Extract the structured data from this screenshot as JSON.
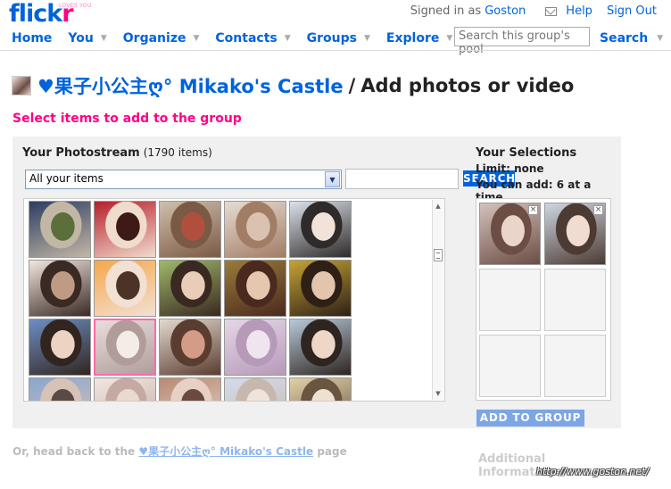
{
  "header": {
    "logo_text": "flick",
    "logo_r": "r",
    "logo_sub": "LOVES YOU",
    "signed_in_as": "Signed in as",
    "username": "Goston",
    "help": "Help",
    "sign_out": "Sign Out",
    "nav": [
      "Home",
      "You",
      "Organize",
      "Contacts",
      "Groups",
      "Explore"
    ],
    "search_placeholder": "Search this group's pool",
    "search_label": "Search"
  },
  "page": {
    "group_name": "♥果子小公主ღ° Mikako's Castle",
    "separator": "/",
    "title_rest": "Add photos or video",
    "subhead": "Select items to add to the group"
  },
  "photostream": {
    "label": "Your Photostream",
    "count": "(1790 items)",
    "filter_selected": "All your items",
    "search_button": "SEARCH"
  },
  "thumbnails": [
    {
      "c1": "#2d3d62",
      "c2": "#c2b7a5",
      "c3": "#5a6f3a",
      "selected": false
    },
    {
      "c1": "#b61f2b",
      "c2": "#f0dccd",
      "c3": "#3d1a16",
      "selected": false
    },
    {
      "c1": "#cfbfae",
      "c2": "#7b5a45",
      "c3": "#b14f3e",
      "selected": false
    },
    {
      "c1": "#e6dcd2",
      "c2": "#a27d66",
      "c3": "#d9c2b0",
      "selected": false
    },
    {
      "c1": "#dbe1ea",
      "c2": "#2f2b2a",
      "c3": "#f2e3d8",
      "selected": false
    },
    {
      "c1": "#f1e6df",
      "c2": "#3b2a24",
      "c3": "#bf9b86",
      "selected": false
    },
    {
      "c1": "#f5a74a",
      "c2": "#f3e0d4",
      "c3": "#4c3327",
      "selected": false
    },
    {
      "c1": "#9fb86b",
      "c2": "#3a2921",
      "c3": "#e8cdb8",
      "selected": false
    },
    {
      "c1": "#9a7b3b",
      "c2": "#4a2a1e",
      "c3": "#e5c7b0",
      "selected": false
    },
    {
      "c1": "#c4a335",
      "c2": "#2f2016",
      "c3": "#e3c5ae",
      "selected": false
    },
    {
      "c1": "#6c8ec3",
      "c2": "#32251f",
      "c3": "#ecd3c2",
      "selected": false
    },
    {
      "c1": "#d7c2c2",
      "c2": "#6f4e45",
      "c3": "#efdcd3",
      "selected": true
    },
    {
      "c1": "#e3d9cf",
      "c2": "#5b3c30",
      "c3": "#d49b86",
      "selected": false
    },
    {
      "c1": "#e4d7e6",
      "c2": "#b79ab9",
      "c3": "#efe5ef",
      "selected": false
    },
    {
      "c1": "#b8c9da",
      "c2": "#2e2521",
      "c3": "#eed7c7",
      "selected": false
    },
    {
      "c1": "#8aa6cf",
      "c2": "#d7c3b6",
      "c3": "#5a4a45",
      "selected": false
    },
    {
      "c1": "#f1e7e1",
      "c2": "#c5a9a3",
      "c3": "#e8d9d1",
      "selected": false
    },
    {
      "c1": "#b78b75",
      "c2": "#e7d1c5",
      "c3": "#6a4a3e",
      "selected": false
    },
    {
      "c1": "#d3dcea",
      "c2": "#c8b7ae",
      "c3": "#efe4dc",
      "selected": false
    },
    {
      "c1": "#e0d0a8",
      "c2": "#6a5540",
      "c3": "#efe1d0",
      "selected": false
    }
  ],
  "selections": {
    "title": "Your Selections",
    "limit": "Limit: none",
    "can_add": "You can add: 6 at a time",
    "slots": [
      {
        "filled": true,
        "c1": "#d3c1bc",
        "c2": "#6c4e44",
        "c3": "#e9d5c9"
      },
      {
        "filled": true,
        "c1": "#cdd6e2",
        "c2": "#4d3a32",
        "c3": "#f0dcd1"
      },
      {
        "filled": false
      },
      {
        "filled": false
      },
      {
        "filled": false
      },
      {
        "filled": false
      }
    ],
    "remove_glyph": "×",
    "add_button": "ADD TO GROUP"
  },
  "footer": {
    "prefix": "Or, head back to the",
    "group_link": "♥果子小公主ღ° Mikako's Castle",
    "suffix": "page",
    "additional_info": "Additional Information",
    "watermark": "http://www.goston.net/"
  }
}
